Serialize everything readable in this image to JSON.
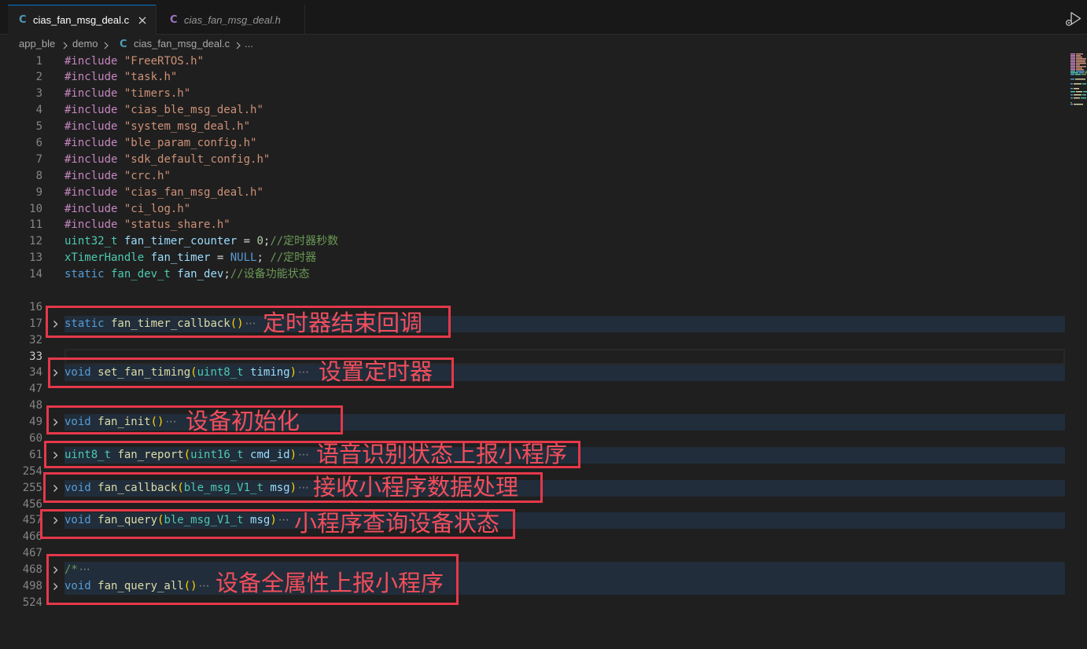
{
  "tabs": [
    {
      "label": "cias_fan_msg_deal.c",
      "icon": "c-file-icon",
      "glyph": "C",
      "color": "#519aba",
      "active": true
    },
    {
      "label": "cias_fan_msg_deal.h",
      "icon": "h-file-icon",
      "glyph": "C",
      "color": "#a074c4",
      "active": false
    }
  ],
  "toolbar": {
    "run_icon": "run-debug-icon",
    "close_icon": "close-icon"
  },
  "breadcrumb": {
    "items": [
      "app_ble",
      "demo"
    ],
    "file_icon": "c-file-icon",
    "file_glyph": "C",
    "file": "cias_fan_msg_deal.c",
    "more": "..."
  },
  "editor": {
    "fold_placeholder": "⋯",
    "lines": [
      {
        "n": "1",
        "tokens": [
          {
            "t": "#include",
            "c": "#c586c0"
          },
          {
            "t": " \"FreeRTOS.h\"",
            "c": "#ce9178"
          }
        ]
      },
      {
        "n": "2",
        "tokens": [
          {
            "t": "#include",
            "c": "#c586c0"
          },
          {
            "t": " \"task.h\"",
            "c": "#ce9178"
          }
        ]
      },
      {
        "n": "3",
        "tokens": [
          {
            "t": "#include",
            "c": "#c586c0"
          },
          {
            "t": " \"timers.h\"",
            "c": "#ce9178"
          }
        ]
      },
      {
        "n": "4",
        "tokens": [
          {
            "t": "#include",
            "c": "#c586c0"
          },
          {
            "t": " \"cias_ble_msg_deal.h\"",
            "c": "#ce9178"
          }
        ]
      },
      {
        "n": "5",
        "tokens": [
          {
            "t": "#include",
            "c": "#c586c0"
          },
          {
            "t": " \"system_msg_deal.h\"",
            "c": "#ce9178"
          }
        ]
      },
      {
        "n": "6",
        "tokens": [
          {
            "t": "#include",
            "c": "#c586c0"
          },
          {
            "t": " \"ble_param_config.h\"",
            "c": "#ce9178"
          }
        ]
      },
      {
        "n": "7",
        "tokens": [
          {
            "t": "#include",
            "c": "#c586c0"
          },
          {
            "t": " \"sdk_default_config.h\"",
            "c": "#ce9178"
          }
        ]
      },
      {
        "n": "8",
        "tokens": [
          {
            "t": "#include",
            "c": "#c586c0"
          },
          {
            "t": " \"crc.h\"",
            "c": "#ce9178"
          }
        ]
      },
      {
        "n": "9",
        "tokens": [
          {
            "t": "#include",
            "c": "#c586c0"
          },
          {
            "t": " \"cias_fan_msg_deal.h\"",
            "c": "#ce9178"
          }
        ]
      },
      {
        "n": "10",
        "tokens": [
          {
            "t": "#include",
            "c": "#c586c0"
          },
          {
            "t": " \"ci_log.h\"",
            "c": "#ce9178"
          }
        ]
      },
      {
        "n": "11",
        "tokens": [
          {
            "t": "#include",
            "c": "#c586c0"
          },
          {
            "t": " \"status_share.h\"",
            "c": "#ce9178"
          }
        ]
      },
      {
        "n": "12",
        "tokens": [
          {
            "t": "uint32_t",
            "c": "#4ec9b0"
          },
          {
            "t": " fan_timer_counter",
            "c": "#9cdcfe"
          },
          {
            "t": " = ",
            "c": "#d4d4d4"
          },
          {
            "t": "0",
            "c": "#b5cea8"
          },
          {
            "t": ";",
            "c": "#d4d4d4"
          },
          {
            "t": "//定时器秒数",
            "c": "#6a9955"
          }
        ]
      },
      {
        "n": "13",
        "tokens": [
          {
            "t": "xTimerHandle",
            "c": "#4ec9b0"
          },
          {
            "t": " fan_timer",
            "c": "#9cdcfe"
          },
          {
            "t": " = ",
            "c": "#d4d4d4"
          },
          {
            "t": "NULL",
            "c": "#569cd6"
          },
          {
            "t": "; ",
            "c": "#d4d4d4"
          },
          {
            "t": "//定时器",
            "c": "#6a9955"
          }
        ]
      },
      {
        "n": "14",
        "tokens": [
          {
            "t": "static",
            "c": "#569cd6"
          },
          {
            "t": " fan_dev_t",
            "c": "#4ec9b0"
          },
          {
            "t": " fan_dev",
            "c": "#9cdcfe"
          },
          {
            "t": ";",
            "c": "#d4d4d4"
          },
          {
            "t": "//设备功能状态",
            "c": "#6a9955"
          }
        ]
      },
      {
        "n": ""
      },
      {
        "n": "16"
      },
      {
        "n": "17",
        "folded": true,
        "tokens": [
          {
            "t": "static",
            "c": "#569cd6"
          },
          {
            "t": " fan_timer_callback",
            "c": "#dcdcaa"
          },
          {
            "t": "()",
            "c": "#ffd700"
          }
        ]
      },
      {
        "n": "32"
      },
      {
        "n": "33",
        "current": true
      },
      {
        "n": "34",
        "folded": true,
        "tokens": [
          {
            "t": "void",
            "c": "#569cd6"
          },
          {
            "t": " set_fan_timing",
            "c": "#dcdcaa"
          },
          {
            "t": "(",
            "c": "#ffd700"
          },
          {
            "t": "uint8_t",
            "c": "#4ec9b0"
          },
          {
            "t": " timing",
            "c": "#9cdcfe"
          },
          {
            "t": ")",
            "c": "#ffd700"
          }
        ]
      },
      {
        "n": "47"
      },
      {
        "n": "48"
      },
      {
        "n": "49",
        "folded": true,
        "tokens": [
          {
            "t": "void",
            "c": "#569cd6"
          },
          {
            "t": " fan_init",
            "c": "#dcdcaa"
          },
          {
            "t": "()",
            "c": "#ffd700"
          }
        ]
      },
      {
        "n": "60"
      },
      {
        "n": "61",
        "folded": true,
        "tokens": [
          {
            "t": "uint8_t",
            "c": "#4ec9b0"
          },
          {
            "t": " fan_report",
            "c": "#dcdcaa"
          },
          {
            "t": "(",
            "c": "#ffd700"
          },
          {
            "t": "uint16_t",
            "c": "#4ec9b0"
          },
          {
            "t": " cmd_id",
            "c": "#9cdcfe"
          },
          {
            "t": ")",
            "c": "#ffd700"
          }
        ]
      },
      {
        "n": "254"
      },
      {
        "n": "255",
        "folded": true,
        "tokens": [
          {
            "t": "void",
            "c": "#569cd6"
          },
          {
            "t": " fan_callback",
            "c": "#dcdcaa"
          },
          {
            "t": "(",
            "c": "#ffd700"
          },
          {
            "t": "ble_msg_V1_t",
            "c": "#4ec9b0"
          },
          {
            "t": " msg",
            "c": "#9cdcfe"
          },
          {
            "t": ")",
            "c": "#ffd700"
          }
        ]
      },
      {
        "n": "456"
      },
      {
        "n": "457",
        "folded": true,
        "tokens": [
          {
            "t": "void",
            "c": "#569cd6"
          },
          {
            "t": " fan_query",
            "c": "#dcdcaa"
          },
          {
            "t": "(",
            "c": "#ffd700"
          },
          {
            "t": "ble_msg_V1_t",
            "c": "#4ec9b0"
          },
          {
            "t": " msg",
            "c": "#9cdcfe"
          },
          {
            "t": ")",
            "c": "#ffd700"
          }
        ]
      },
      {
        "n": "466"
      },
      {
        "n": "467"
      },
      {
        "n": "468",
        "folded": true,
        "tokens": [
          {
            "t": "/*",
            "c": "#6a9955"
          }
        ]
      },
      {
        "n": "498",
        "folded": true,
        "tokens": [
          {
            "t": "void",
            "c": "#569cd6"
          },
          {
            "t": " fan_query_all",
            "c": "#dcdcaa"
          },
          {
            "t": "()",
            "c": "#ffd700"
          }
        ]
      },
      {
        "n": "524"
      }
    ]
  },
  "annotations": {
    "border_color": "#e5384a",
    "text_color": "#f24e5c",
    "items": [
      {
        "text": "定时器结束回调"
      },
      {
        "text": "设置定时器"
      },
      {
        "text": "设备初始化"
      },
      {
        "text": "语音识别状态上报小程序"
      },
      {
        "text": "接收小程序数据处理"
      },
      {
        "text": "小程序查询设备状态"
      },
      {
        "text": "设备全属性上报小程序"
      }
    ]
  }
}
